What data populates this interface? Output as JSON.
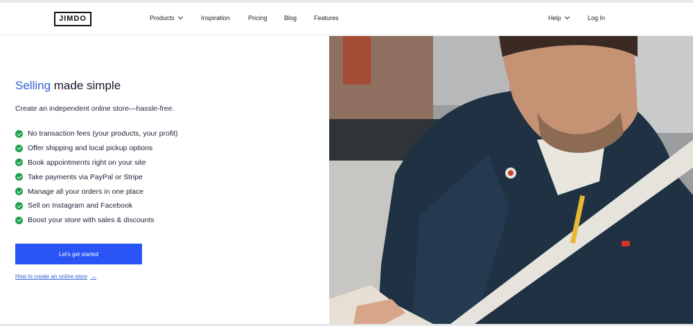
{
  "nav": {
    "logo": "JIMDO",
    "items": [
      {
        "label": "Products",
        "has_dropdown": true
      },
      {
        "label": "Inspiration"
      },
      {
        "label": "Pricing"
      },
      {
        "label": "Blog"
      },
      {
        "label": "Features"
      }
    ],
    "help": "Help",
    "login": "Log In"
  },
  "hero": {
    "title_accent": "Selling",
    "title_rest": " made simple",
    "subtitle": "Create an independent online store—hassle-free.",
    "features": [
      "No transaction fees (your products, your profit)",
      "Offer shipping and local pickup options",
      "Book appointments right on your site",
      "Take payments via PayPal or Stripe",
      "Manage all your orders in one place",
      "Sell on Instagram and Facebook",
      "Boost your store with sales & discounts"
    ],
    "cta_label": "Let's get started",
    "link_label": "How to create an online store",
    "link_arrow": "→"
  },
  "colors": {
    "accent": "#2c5fd6",
    "button": "#2a55f4",
    "check": "#1aa14a"
  },
  "icons": {
    "check": "check-circle-icon",
    "dropdown": "chevron-down-icon",
    "link_arrow": "arrow-right-icon"
  }
}
